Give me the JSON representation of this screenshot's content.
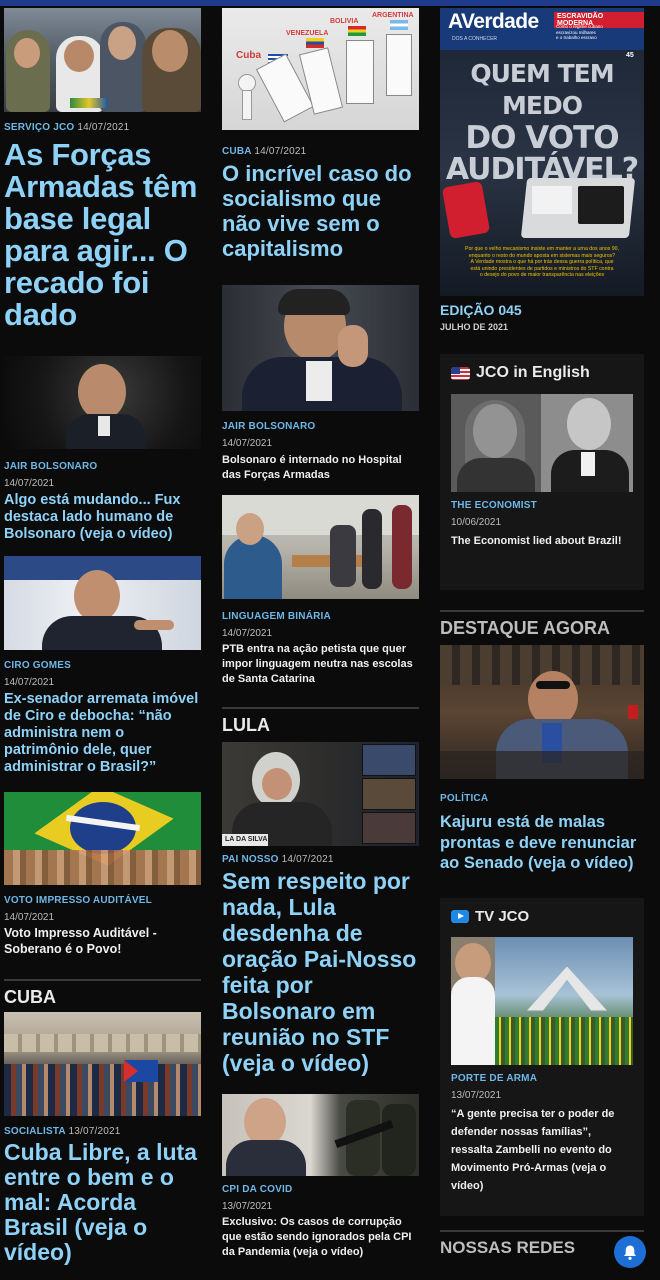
{
  "col1": {
    "a1": {
      "cat": "SERVIÇO JCO",
      "date": "14/07/2021",
      "title": "As Forças Armadas têm base legal para agir... O recado foi dado"
    },
    "a2": {
      "cat": "JAIR BOLSONARO",
      "date": "14/07/2021",
      "title": "Algo está mudando... Fux destaca lado humano de Bolsonaro (veja o vídeo)"
    },
    "a3": {
      "cat": "CIRO GOMES",
      "date": "14/07/2021",
      "title": "Ex-senador arremata imóvel de Ciro e debocha: “não administra nem o patrimônio dele, quer administrar o Brasil?”"
    },
    "a4": {
      "cat": "VOTO IMPRESSO AUDITÁVEL",
      "date": "14/07/2021",
      "title": "Voto Impresso Auditável - Soberano é o Povo!"
    },
    "section": "CUBA",
    "a5": {
      "cat": "SOCIALISTA",
      "date": "13/07/2021",
      "title": "Cuba Libre, a luta entre o bem e o mal: Acorda Brasil (veja o vídeo)"
    }
  },
  "col2": {
    "img1_labels": {
      "a": "ARGENTINA",
      "b": "BOLIVIA",
      "c": "VENEZUELA",
      "d": "Cuba"
    },
    "a1": {
      "cat": "CUBA",
      "date": "14/07/2021",
      "title": "O incrível caso do socialismo que não vive sem o capitalismo"
    },
    "a2": {
      "cat": "JAIR BOLSONARO",
      "date": "14/07/2021",
      "title": "Bolsonaro é internado no Hospital das Forças Armadas"
    },
    "a3": {
      "cat": "LINGUAGEM BINÁRIA",
      "date": "14/07/2021",
      "title": "PTB entra na ação petista que quer impor linguagem neutra nas escolas de Santa Catarina"
    },
    "section": "LULA",
    "lula_caption": "LA DA SILVA",
    "a4": {
      "cat": "PAI NOSSO",
      "date": "14/07/2021",
      "title": "Sem respeito por nada, Lula desdenha de oração Pai-Nosso feita por Bolsonaro em reunião no STF (veja o vídeo)"
    },
    "a5": {
      "cat": "CPI DA COVID",
      "date": "13/07/2021",
      "title": "Exclusivo: Os casos de corrupção que estão sendo ignorados pela CPI da Pandemia (veja o vídeo)"
    }
  },
  "col3": {
    "magazine": {
      "brand": "AVerdade",
      "brand_sub": "DOS A CONHECER",
      "tag": "ESCRAVIDÃO MODERNA",
      "tag_lines": [
        "Como o regime cubano",
        "escravizou milhares",
        "e o trabalho escravo"
      ],
      "issue_num": "45",
      "headline": [
        "QUEM TEM MEDO",
        "DO VOTO",
        "AUDITÁVEL?"
      ],
      "blurb": [
        "Por que o velho mecanismo insiste em manter a urna dos anos 90,",
        "enquanto o resto do mundo aposta em sistemas mais seguros?",
        "A Verdade mostra o que há por trás dessa guerra política, que",
        "está unindo presidentes de partidos e ministros do STF contra",
        "o desejo do povo de maior transparência nas eleições"
      ]
    },
    "edition": {
      "title": "EDIÇÃO 045",
      "date": "JULHO DE 2021"
    },
    "english": {
      "header": "JCO in English",
      "cat": "THE ECONOMIST",
      "date": "10/06/2021",
      "title": "The Economist lied about Brazil!"
    },
    "destaque": {
      "section": "DESTAQUE AGORA",
      "cat": "POLÍTICA",
      "title": "Kajuru está de malas prontas e deve renunciar ao Senado (veja o vídeo)"
    },
    "tv": {
      "header": "TV JCO",
      "cat": "PORTE DE ARMA",
      "date": "13/07/2021",
      "title": "“A gente precisa ter o poder de defender nossas famílias”, ressalta Zambelli no evento do Movimento Pró-Armas (veja o vídeo)"
    },
    "redes": "NOSSAS REDES"
  },
  "colors": {
    "accent": "#8fd2f7",
    "category": "#6fb7e6",
    "background": "#0b0b0c",
    "bell": "#1d6fd6"
  }
}
